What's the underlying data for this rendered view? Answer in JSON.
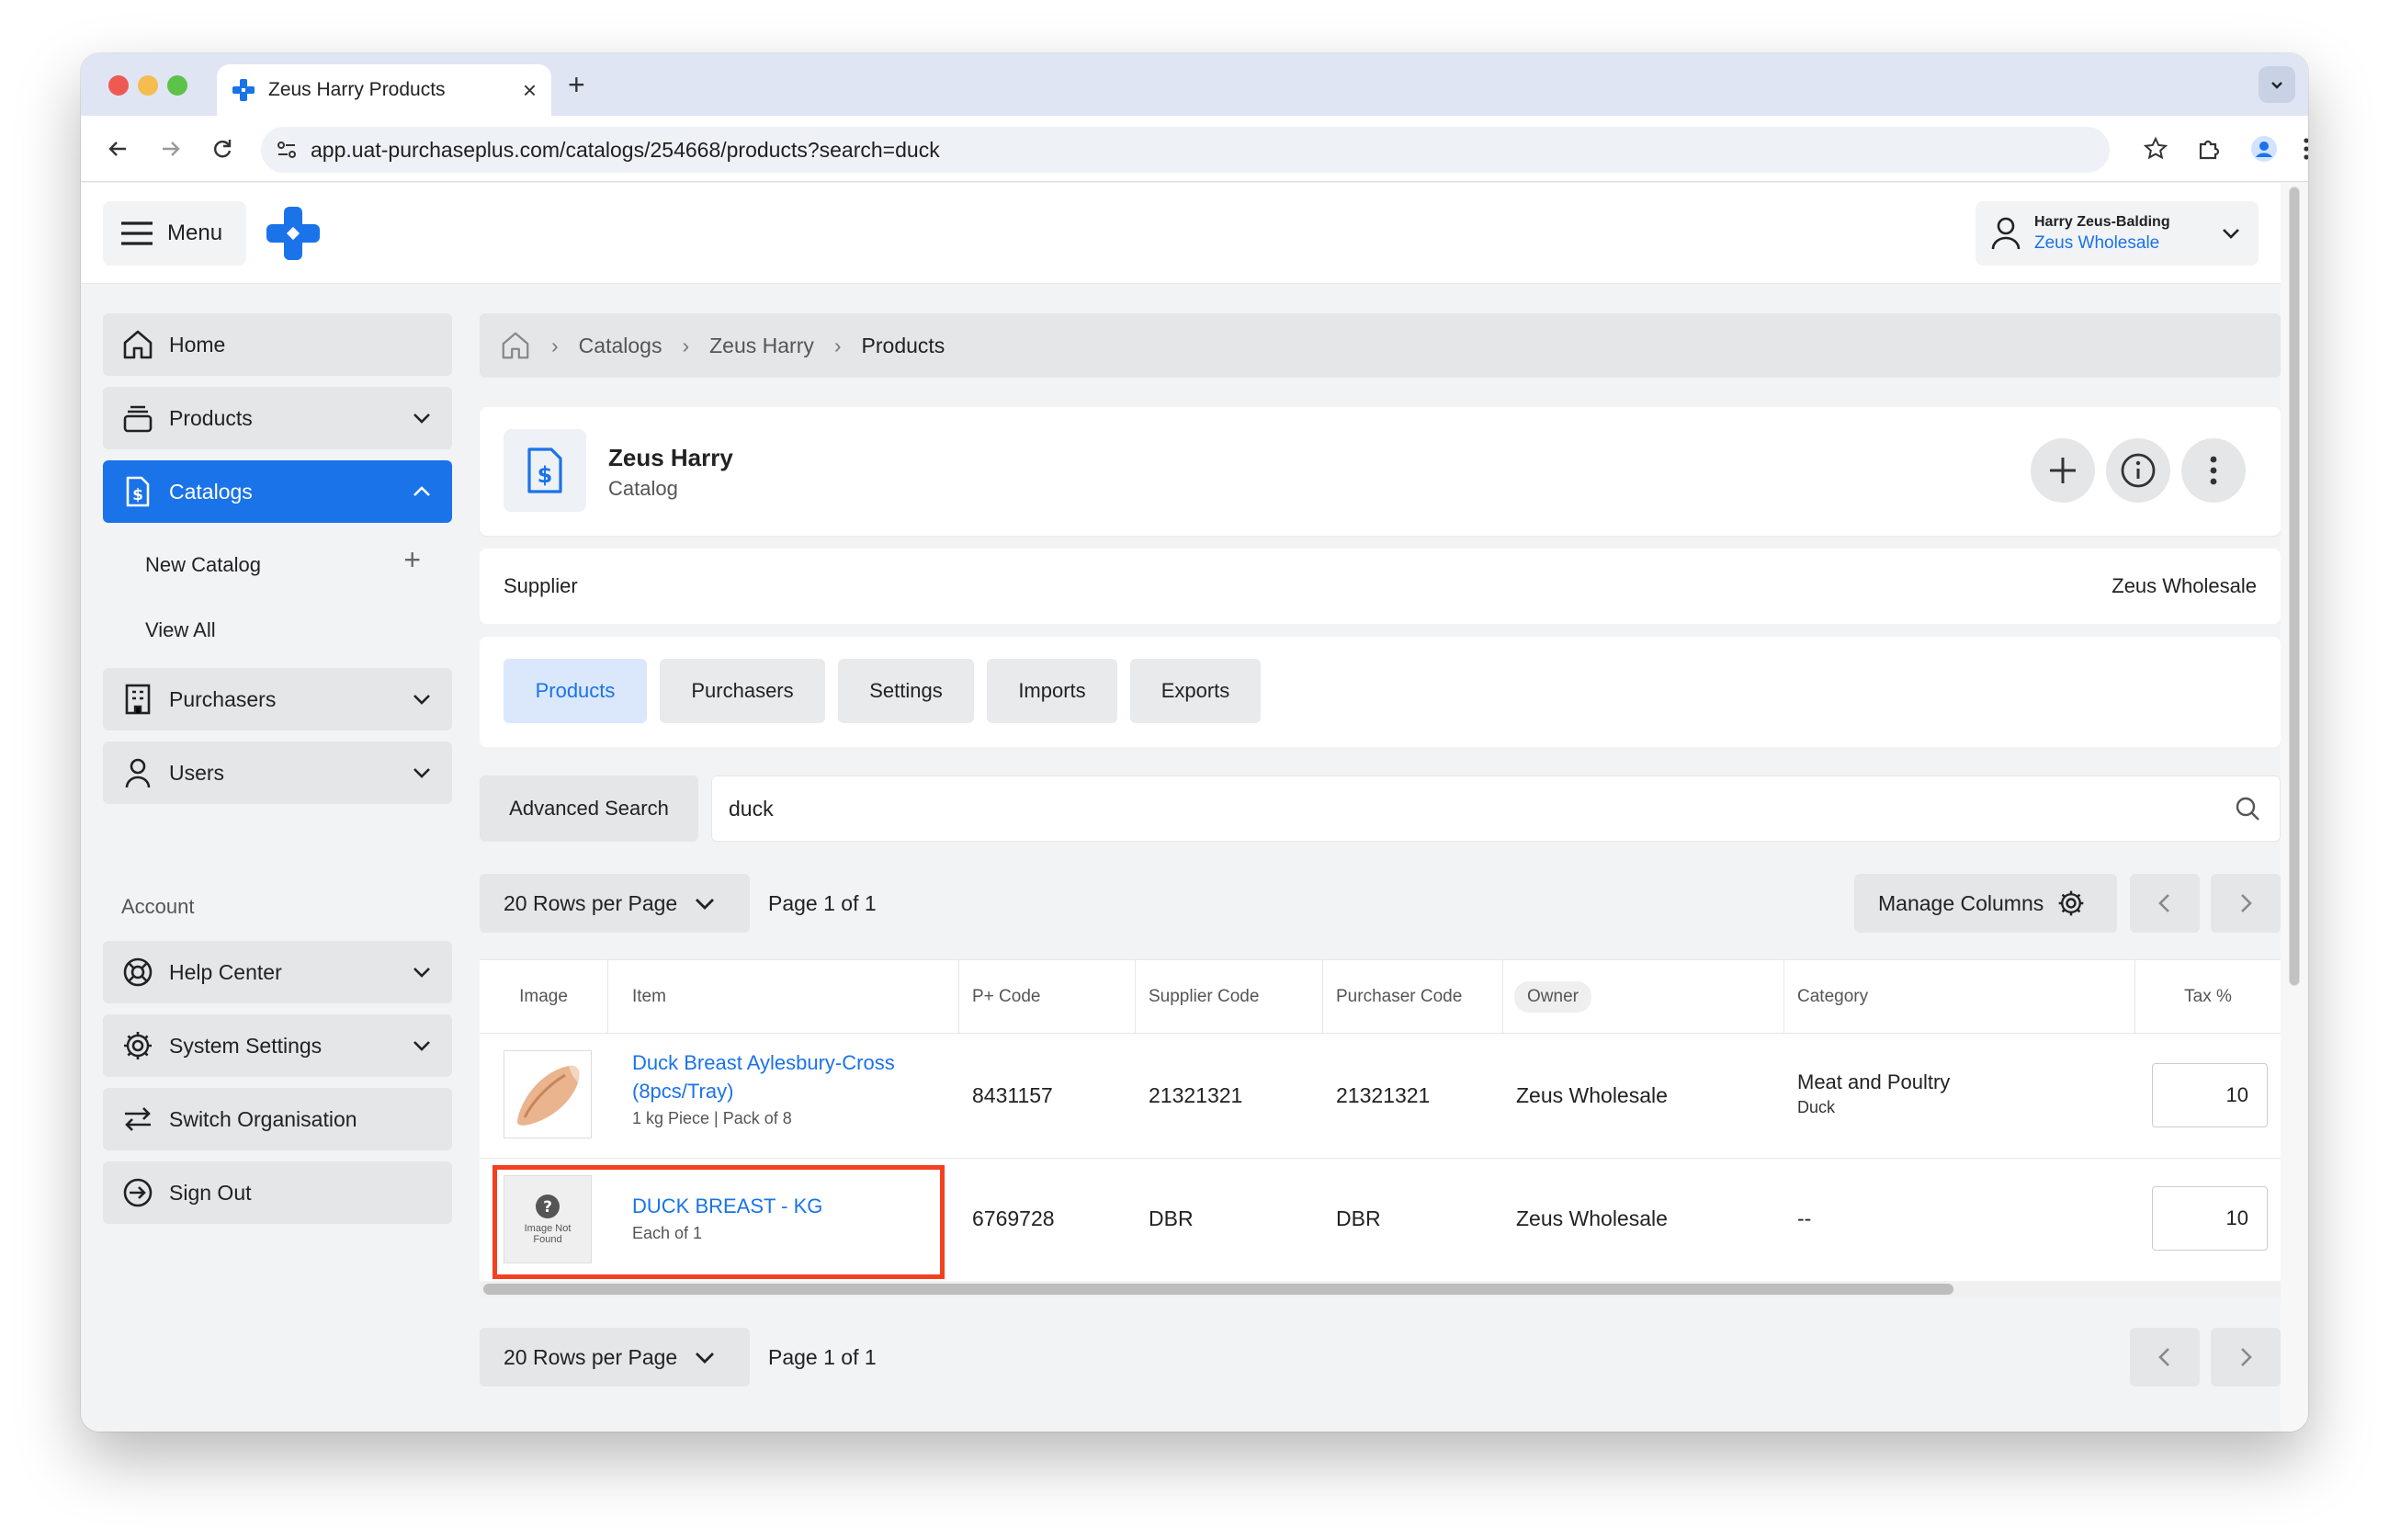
{
  "browser": {
    "tab_title": "Zeus Harry Products",
    "url": "app.uat-purchaseplus.com/catalogs/254668/products?search=duck"
  },
  "topbar": {
    "menu_label": "Menu",
    "user_name": "Harry Zeus-Balding",
    "user_org": "Zeus Wholesale"
  },
  "sidebar": {
    "home": "Home",
    "products": "Products",
    "catalogs": "Catalogs",
    "new_catalog": "New Catalog",
    "view_all": "View All",
    "purchasers": "Purchasers",
    "users": "Users",
    "account_label": "Account",
    "help_center": "Help Center",
    "system_settings": "System Settings",
    "switch_org": "Switch Organisation",
    "sign_out": "Sign Out"
  },
  "breadcrumb": {
    "items": [
      "Catalogs",
      "Zeus Harry",
      "Products"
    ]
  },
  "catalog": {
    "title": "Zeus Harry",
    "subtitle": "Catalog",
    "supplier_label": "Supplier",
    "supplier_value": "Zeus Wholesale"
  },
  "tabs": [
    "Products",
    "Purchasers",
    "Settings",
    "Imports",
    "Exports"
  ],
  "search": {
    "advanced_label": "Advanced Search",
    "value": "duck"
  },
  "pagination": {
    "rows_label": "20 Rows per Page",
    "page_text": "Page 1 of 1",
    "manage_columns": "Manage Columns"
  },
  "table": {
    "headers": [
      "Image",
      "Item",
      "P+ Code",
      "Supplier Code",
      "Purchaser Code",
      "Owner",
      "Category",
      "Tax %"
    ],
    "rows": [
      {
        "name": "Duck Breast Aylesbury-Cross (8pcs/Tray)",
        "meta": "1 kg Piece | Pack of 8",
        "pcode": "8431157",
        "supplier_code": "21321321",
        "purchaser_code": "21321321",
        "owner": "Zeus Wholesale",
        "category": "Meat and Poultry",
        "subcategory": "Duck",
        "tax": "10"
      },
      {
        "name": "DUCK BREAST - KG",
        "meta": "Each of 1",
        "pcode": "6769728",
        "supplier_code": "DBR",
        "purchaser_code": "DBR",
        "owner": "Zeus Wholesale",
        "category": "--",
        "subcategory": "",
        "tax": "10",
        "image_placeholder": "Image Not Found"
      }
    ]
  },
  "colors": {
    "accent": "#1a73e8",
    "highlight": "#f4401e"
  }
}
